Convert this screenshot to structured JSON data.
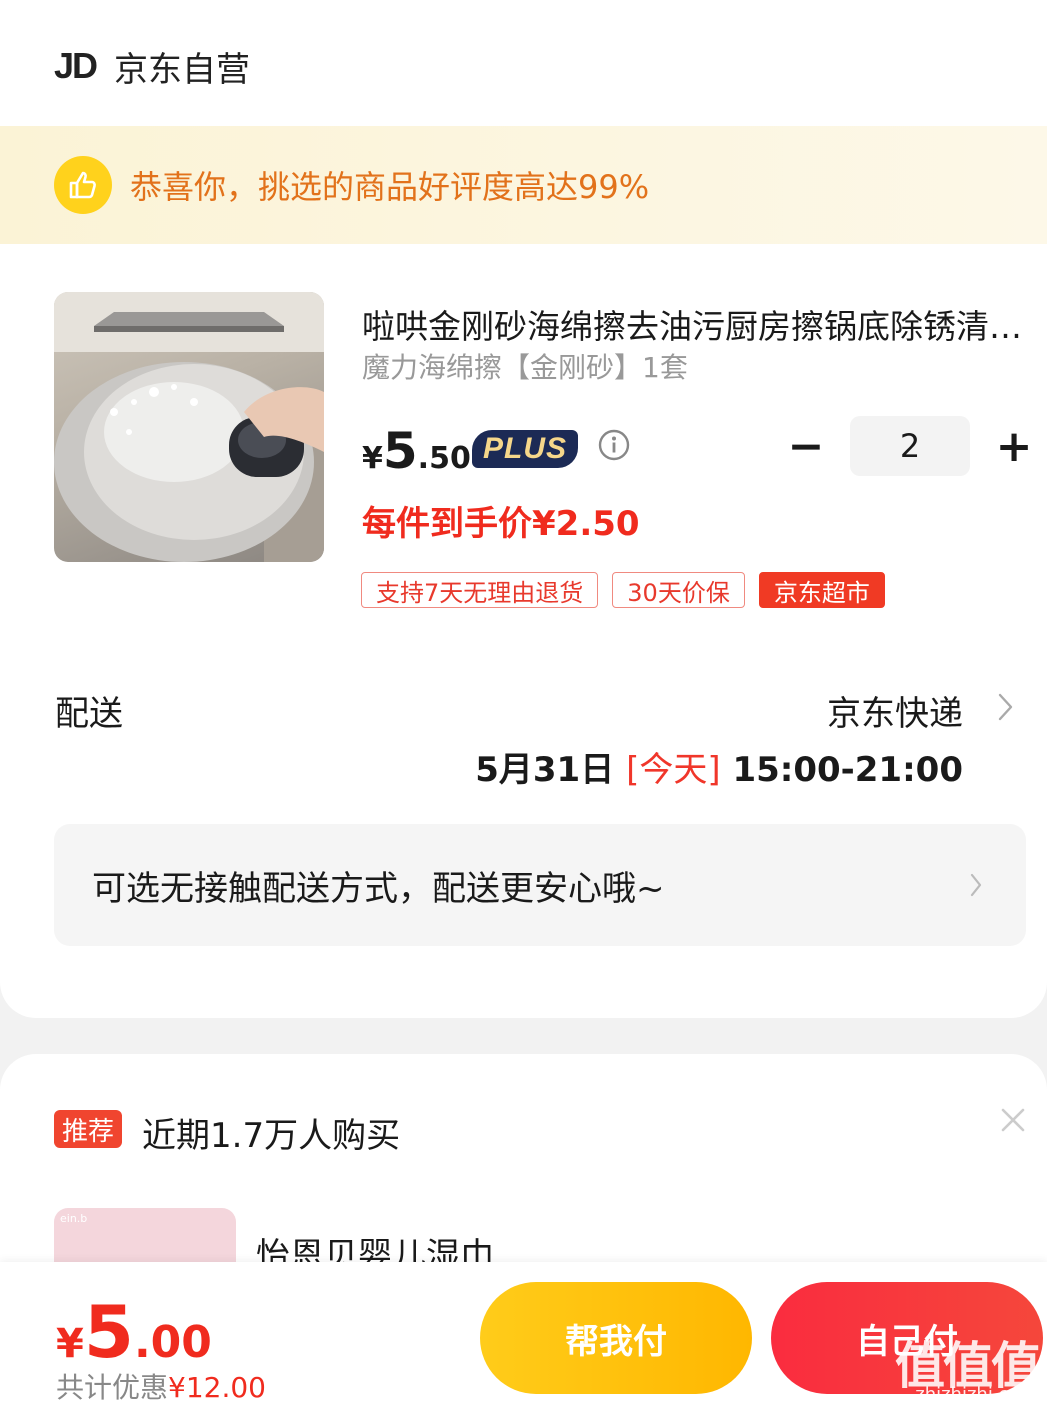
{
  "store": {
    "logo": "JD",
    "name": "京东自营"
  },
  "banner": {
    "text": "恭喜你，挑选的商品好评度高达99%"
  },
  "product": {
    "title": "啦哄金刚砂海绵擦去油污厨房擦锅底除锈清洁刷锅神器",
    "sku": "魔力海绵擦【金刚砂】1套",
    "price_symbol": "¥",
    "price_int": "5",
    "price_dec": ".50",
    "plus_label": "PLUS",
    "quantity": "2",
    "minus_label": "−",
    "plus_btn_label": "+",
    "unit_price": "每件到手价¥2.50",
    "tags": [
      "支持7天无理由退货",
      "30天价保",
      "京东超市"
    ]
  },
  "shipping": {
    "label": "配送",
    "method": "京东快递",
    "date": "5月31日",
    "today": "[今天]",
    "window": "15:00-21:00"
  },
  "contactless": {
    "text": "可选无接触配送方式，配送更安心哦~"
  },
  "recommend": {
    "badge": "推荐",
    "text": "近期1.7万人购买",
    "item_title": "怡恩贝婴儿湿巾",
    "item_logo": "ein.b"
  },
  "footer": {
    "total_symbol": "¥",
    "total_int": "5",
    "total_dec": ".00",
    "discount_label": "共计优惠",
    "discount_amount": "¥12.00",
    "help_pay": "帮我付",
    "self_pay": "自己付"
  },
  "watermark": {
    "text": "值值值",
    "sub": "zhizhizhi.com"
  },
  "colors": {
    "price_red": "#f02b1e",
    "banner_text": "#e2721b",
    "help_btn": "#ffc107",
    "self_btn": "#fa2c3f"
  },
  "icons": [
    "thumbs-up-icon",
    "info-icon",
    "chevron-right-icon",
    "close-icon"
  ]
}
